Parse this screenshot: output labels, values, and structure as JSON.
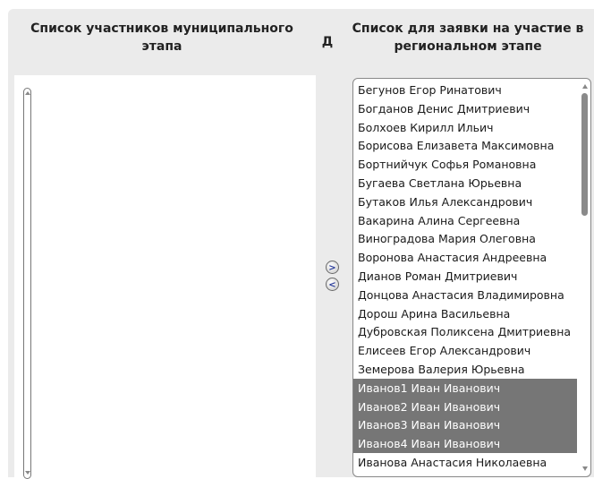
{
  "headers": {
    "left": "Список участников муниципального этапа",
    "middle": "Д",
    "right": "Список для заявки на участие в региональном этапе"
  },
  "buttons": {
    "move_right": ">",
    "move_left": "<"
  },
  "left_list": {
    "items": []
  },
  "right_list": {
    "items": [
      {
        "label": "Бегунов Егор Ринатович",
        "selected": false
      },
      {
        "label": "Богданов Денис Дмитриевич",
        "selected": false
      },
      {
        "label": "Болхоев Кирилл Ильич",
        "selected": false
      },
      {
        "label": "Борисова Елизавета Максимовна",
        "selected": false
      },
      {
        "label": "Бортнийчук Софья Романовна",
        "selected": false
      },
      {
        "label": "Бугаева Светлана Юрьевна",
        "selected": false
      },
      {
        "label": "Бутаков Илья Александрович",
        "selected": false
      },
      {
        "label": "Вакарина Алина Сергеевна",
        "selected": false
      },
      {
        "label": "Виноградова Мария Олеговна",
        "selected": false
      },
      {
        "label": "Воронова Анастасия Андреевна",
        "selected": false
      },
      {
        "label": "Дианов Роман Дмитриевич",
        "selected": false
      },
      {
        "label": "Донцова Анастасия Владимировна",
        "selected": false
      },
      {
        "label": "Дорош Арина Васильевна",
        "selected": false
      },
      {
        "label": "Дубровская Поликсена Дмитриевна",
        "selected": false
      },
      {
        "label": "Елисеев Егор Александрович",
        "selected": false
      },
      {
        "label": "Земерова Валерия Юрьевна",
        "selected": false
      },
      {
        "label": "Иванов1 Иван Иванович",
        "selected": true
      },
      {
        "label": "Иванов2 Иван Иванович",
        "selected": true
      },
      {
        "label": "Иванов3 Иван Иванович",
        "selected": true
      },
      {
        "label": "Иванов4 Иван Иванович",
        "selected": true
      },
      {
        "label": "Иванова Анастасия Николаевна",
        "selected": false
      }
    ]
  },
  "colors": {
    "panel_bg": "#ebebeb",
    "selection_bg": "#767676",
    "selection_text": "#ffffff",
    "button_glyph": "#2a3c9a"
  }
}
